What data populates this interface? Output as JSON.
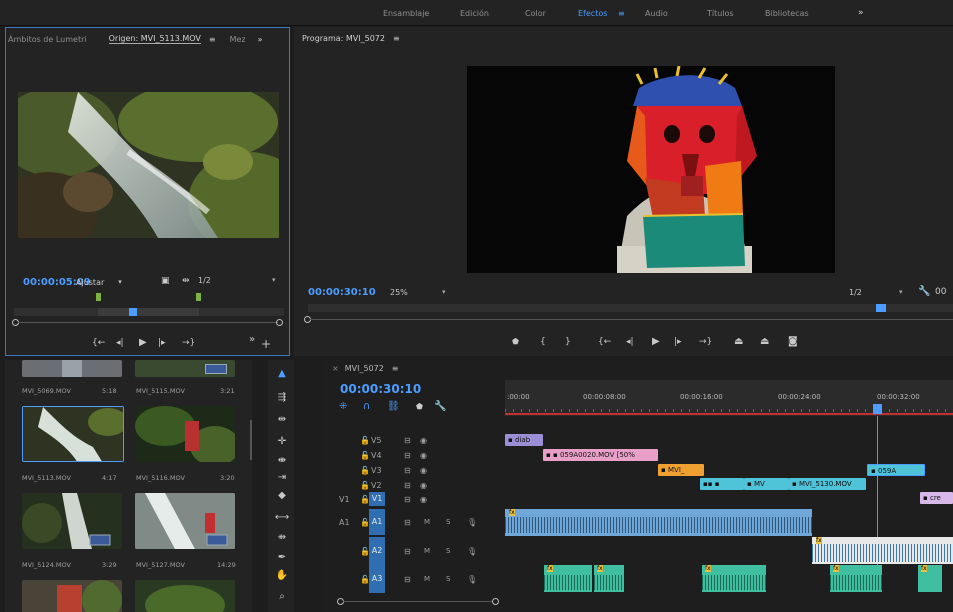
{
  "workspaces": [
    "Ensamblaje",
    "Edición",
    "Color",
    "Efectos",
    "Audio",
    "Títulos",
    "Bibliotecas"
  ],
  "active_workspace": "Efectos",
  "source_panel": {
    "tab_lumetri": "Ámbitos de Lumetri",
    "tab_origin": "Origen: MVI_5113.MOV",
    "tab_mez": "Mez",
    "timecode": "00:00:05:09",
    "fit": "Ajustar",
    "resolution": "1/2"
  },
  "program_panel": {
    "title": "Programa: MVI_5072",
    "timecode": "00:00:30:10",
    "zoom": "25%",
    "resolution": "1/2",
    "duration_partial": "00"
  },
  "project_bin": [
    {
      "name": "MVI_5069.MOV",
      "duration": "5:18"
    },
    {
      "name": "MVI_5115.MOV",
      "duration": "3:21"
    },
    {
      "name": "MVI_5113.MOV",
      "duration": "4:17"
    },
    {
      "name": "MVI_5116.MOV",
      "duration": "3:20"
    },
    {
      "name": "MVI_5124.MOV",
      "duration": "3:29"
    },
    {
      "name": "MVI_5127.MOV",
      "duration": "14:29"
    }
  ],
  "timeline": {
    "sequence_tab": "MVI_5072",
    "timecode": "00:00:30:10",
    "ruler_labels": [
      ":00:00",
      "00:00:08:00",
      "00:00:16:00",
      "00:00:24:00",
      "00:00:32:00"
    ],
    "video_tracks": [
      "V5",
      "V4",
      "V3",
      "V2",
      "V1"
    ],
    "audio_tracks": [
      "A1",
      "A2",
      "A3"
    ],
    "source_v": "V1",
    "source_a": "A1",
    "clips": {
      "diab": "diab",
      "v4": "059A0020.MOV [50%",
      "v3a": "MVI_",
      "v3b": "059A",
      "v2a": "MV",
      "v2b": "MVI_5130.MOV",
      "v1": "cre"
    },
    "m_label": "M",
    "s_label": "S",
    "fx_label": "fx"
  },
  "colors": {
    "accent_blue": "#4d9cff",
    "clip_purple": "#9c8fd6",
    "clip_pink": "#e8a0c8",
    "clip_orange": "#f0a030",
    "clip_cyan": "#4fc3d8",
    "clip_lavender": "#d8b8e8",
    "audio_teal": "#3fbfa0",
    "audio_selected": "#6fa8d8"
  }
}
